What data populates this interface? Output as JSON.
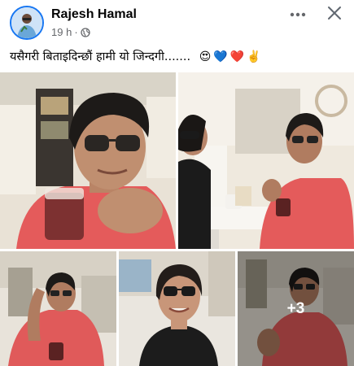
{
  "post": {
    "author_name": "Rajesh Hamal",
    "timestamp": "19 h",
    "separator": "·",
    "audience_icon": "globe-icon",
    "caption": "यसैगरी बिताइदिन्छौं हामी यो जिन्दगी.......",
    "caption_emojis": [
      "😍",
      "💙",
      "❤️",
      "✌️"
    ]
  },
  "header_actions": {
    "more_icon": "more-horizontal-icon",
    "close_icon": "close-icon"
  },
  "photos": {
    "extra_count_label": "+3"
  },
  "colors": {
    "brand_blue": "#1877f2",
    "secondary_text": "#65676b"
  }
}
